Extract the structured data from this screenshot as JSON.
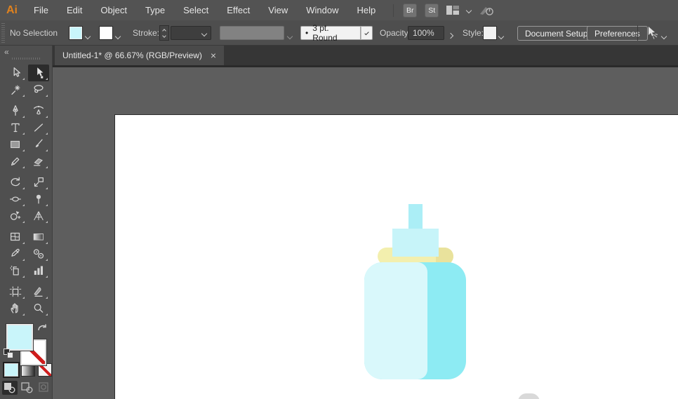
{
  "menubar": {
    "logo": "Ai",
    "items": [
      "File",
      "Edit",
      "Object",
      "Type",
      "Select",
      "Effect",
      "View",
      "Window",
      "Help"
    ],
    "bridge_label": "Br",
    "stock_label": "St"
  },
  "control_bar": {
    "selection_status": "No Selection",
    "stroke_label": "Stroke:",
    "brush_dot": "•",
    "brush_preset": "3 pt. Round",
    "opacity_label": "Opacity:",
    "opacity_value": "100%",
    "style_label": "Style:",
    "document_setup_label": "Document Setup",
    "preferences_label": "Preferences",
    "fill_color": "#c9f5fa"
  },
  "document_tab": {
    "title": "Untitled-1* @ 66.67% (RGB/Preview)",
    "close_glyph": "×"
  },
  "toolbar": {
    "collapse_glyph": "«",
    "fill_color": "#c9f5fa",
    "tools": [
      {
        "name": "selection-tool"
      },
      {
        "name": "direct-selection-tool",
        "active": true
      },
      {
        "name": "magic-wand-tool"
      },
      {
        "name": "lasso-tool"
      },
      {
        "name": "pen-tool"
      },
      {
        "name": "curvature-tool"
      },
      {
        "name": "type-tool"
      },
      {
        "name": "line-segment-tool"
      },
      {
        "name": "rectangle-tool"
      },
      {
        "name": "paintbrush-tool"
      },
      {
        "name": "pencil-tool"
      },
      {
        "name": "eraser-tool"
      },
      {
        "name": "rotate-tool"
      },
      {
        "name": "scale-tool"
      },
      {
        "name": "width-tool"
      },
      {
        "name": "puppet-warp-tool"
      },
      {
        "name": "shape-builder-tool"
      },
      {
        "name": "perspective-grid-tool"
      },
      {
        "name": "mesh-tool"
      },
      {
        "name": "gradient-tool"
      },
      {
        "name": "eyedropper-tool"
      },
      {
        "name": "blend-tool"
      },
      {
        "name": "symbol-sprayer-tool"
      },
      {
        "name": "column-graph-tool"
      },
      {
        "name": "artboard-tool"
      },
      {
        "name": "slice-tool"
      },
      {
        "name": "hand-tool"
      },
      {
        "name": "zoom-tool"
      }
    ]
  },
  "artwork": {
    "bottle": {
      "body_light": "#d9f8fb",
      "body_shade": "#8debf3",
      "collar_light": "#f3efae",
      "collar_shade": "#e9e29c",
      "nipple": "#c7f4f9",
      "nipple_tip": "#abeef6",
      "partial_shape_gray": "#d9d9d9"
    }
  }
}
